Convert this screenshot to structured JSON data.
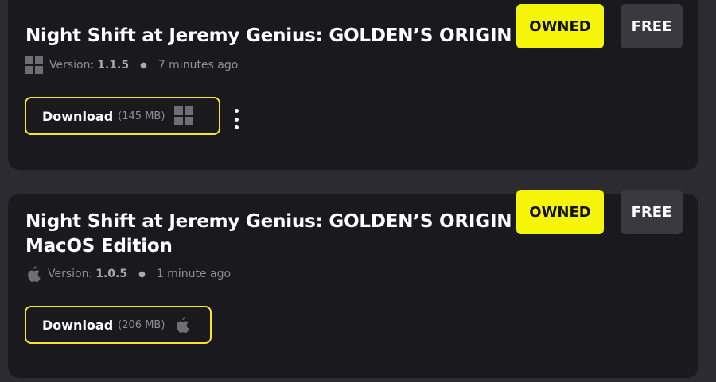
{
  "items": [
    {
      "title_lines": [
        "Night Shift at Jeremy Genius: GOLDEN’S ORIGIN"
      ],
      "platform_icon": "windows-icon",
      "version_label": "Version:",
      "version": "1.1.5",
      "updated": "7 minutes ago",
      "download_label": "Download",
      "download_size": "(145 MB)",
      "owned_label": "OWNED",
      "price_label": "FREE"
    },
    {
      "title_lines": [
        "Night Shift at Jeremy Genius: GOLDEN’S ORIGIN",
        "MacOS Edition"
      ],
      "platform_icon": "apple-icon",
      "version_label": "Version:",
      "version": "1.0.5",
      "updated": "1 minute ago",
      "download_label": "Download",
      "download_size": "(206 MB)",
      "owned_label": "OWNED",
      "price_label": "FREE"
    }
  ],
  "colors": {
    "accent": "#f5e62a",
    "owned_badge": "#f5f509",
    "card_bg": "#1a191e",
    "page_bg": "#2c2b31"
  }
}
